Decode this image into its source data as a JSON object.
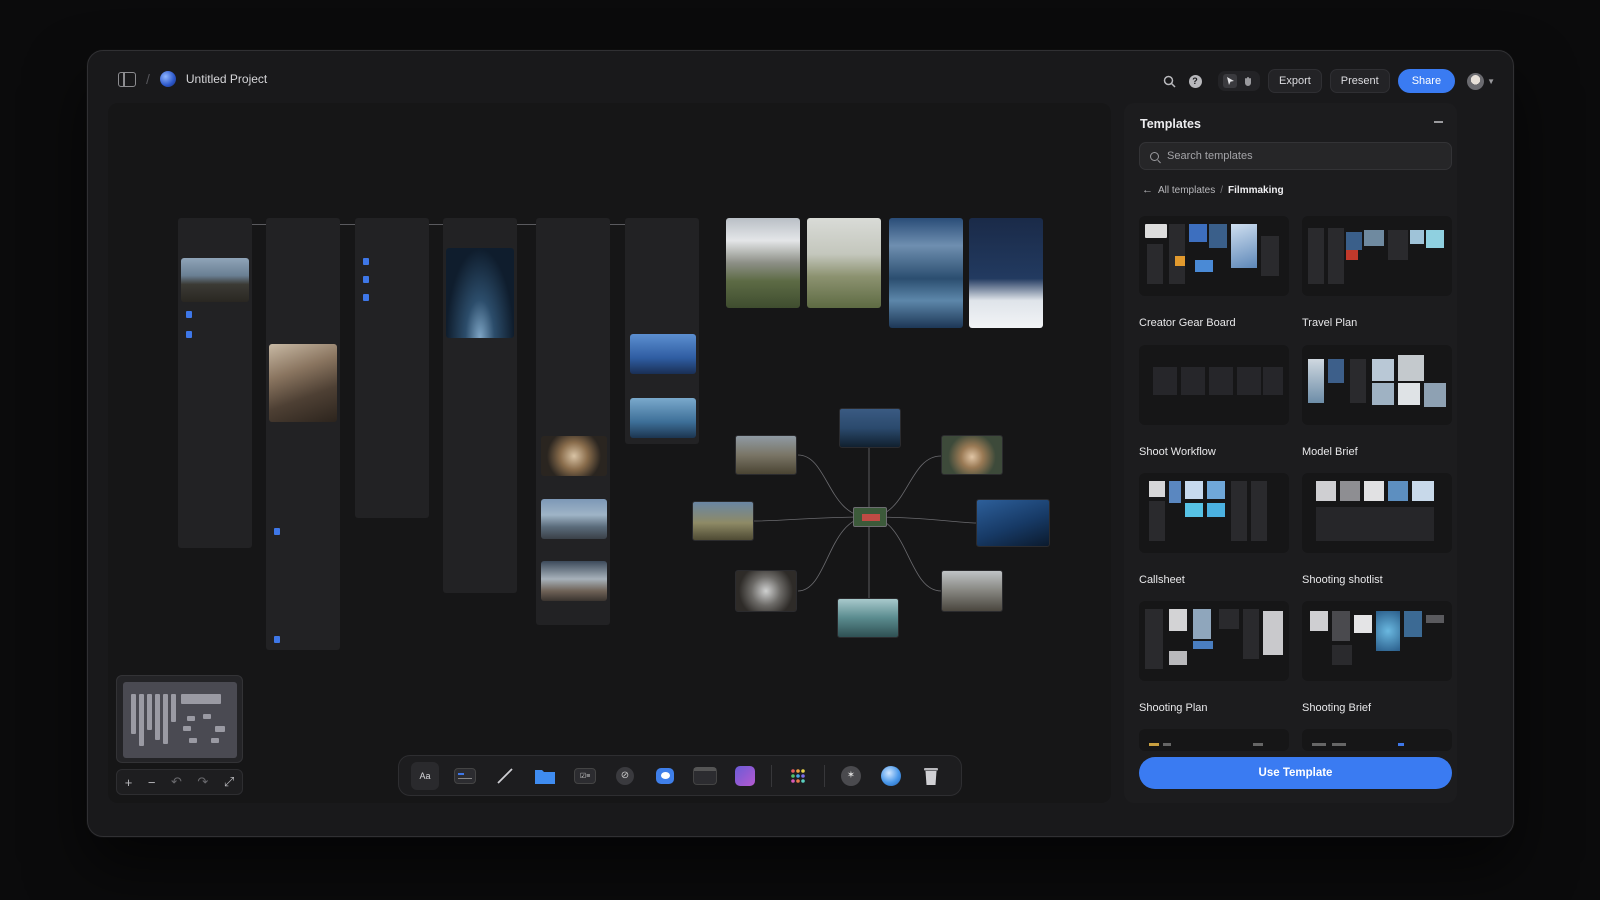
{
  "header": {
    "project_title": "Untitled Project",
    "export_label": "Export",
    "present_label": "Present",
    "share_label": "Share"
  },
  "templates_panel": {
    "title": "Templates",
    "search_placeholder": "Search templates",
    "breadcrumb": {
      "root": "All templates",
      "separator": "/",
      "current": "Filmmaking"
    },
    "items": [
      {
        "label": "Creator Gear Board"
      },
      {
        "label": "Travel Plan"
      },
      {
        "label": "Shoot Workflow"
      },
      {
        "label": "Model Brief"
      },
      {
        "label": "Callsheet"
      },
      {
        "label": "Shooting shotlist"
      },
      {
        "label": "Shooting Plan"
      },
      {
        "label": "Shooting Brief"
      }
    ],
    "use_template_label": "Use Template"
  },
  "toolbar": {
    "text_tool_label": "Aa",
    "icons": [
      "text-icon",
      "card-icon",
      "line-icon",
      "folder-icon",
      "checklist-icon",
      "link-icon",
      "comment-icon",
      "table-icon",
      "image-icon",
      "apps-icon",
      "ai-icon",
      "globe-icon",
      "trash-icon"
    ]
  },
  "colors": {
    "accent": "#3a7bf2",
    "window_bg": "#19191b",
    "panel_bg": "#1c1c1e"
  }
}
